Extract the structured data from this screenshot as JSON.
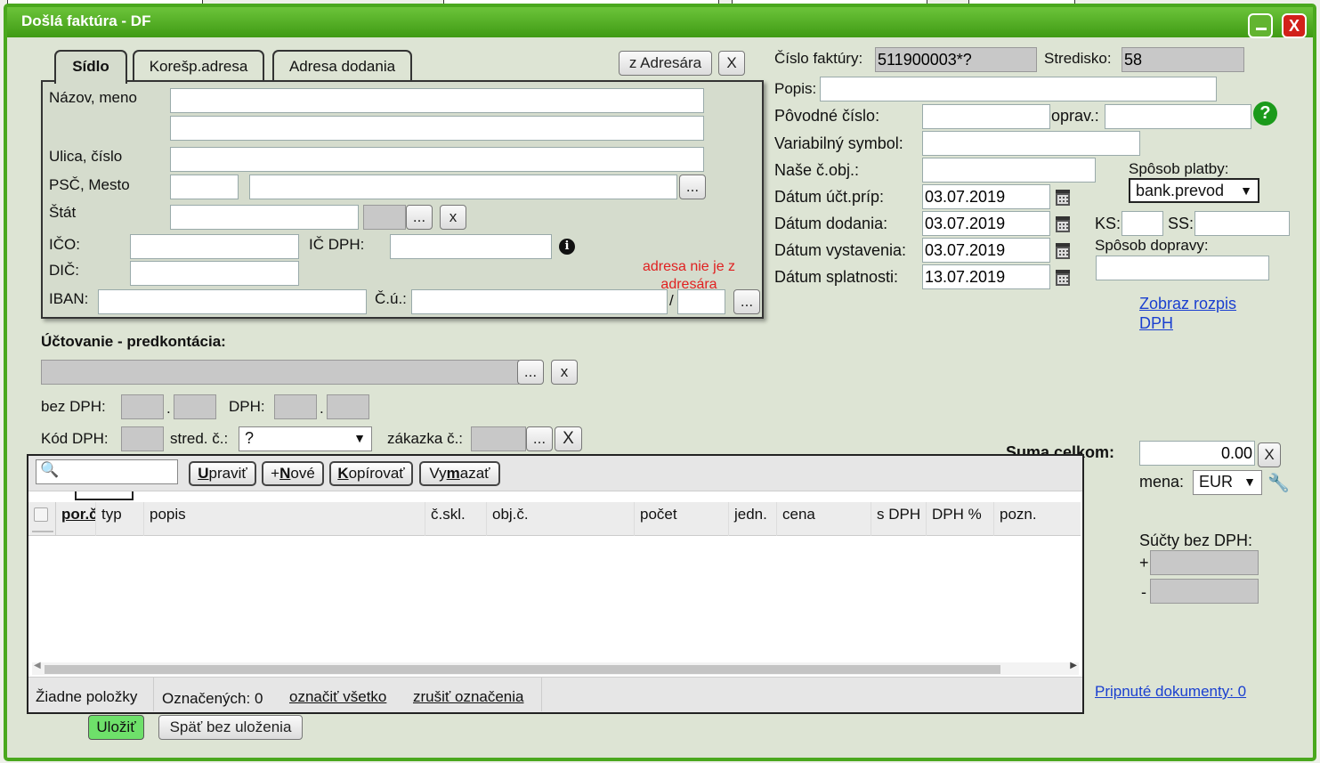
{
  "window": {
    "title": "Došlá faktúra - DF",
    "minimize_icon": "minimize-icon",
    "close_label": "X"
  },
  "address": {
    "tabs": [
      {
        "label": "Sídlo",
        "active": true
      },
      {
        "label": "Korešp.adresa",
        "active": false
      },
      {
        "label": "Adresa dodania",
        "active": false
      }
    ],
    "from_address_book_label": "z Adresára",
    "clear_label": "X",
    "name_label": "Názov, meno",
    "street_label": "Ulica, číslo",
    "zip_city_label": "PSČ, Mesto",
    "country_label": "Štát",
    "ico_label": "IČO:",
    "ic_dph_label": "IČ DPH:",
    "dic_label": "DIČ:",
    "iban_label": "IBAN:",
    "account_label": "Č.ú.:",
    "slash": "/",
    "ellipsis": "...",
    "x_label": "x",
    "not_in_book_warning": "adresa nie je z adresára",
    "warning_color": "#e02020"
  },
  "accounting": {
    "heading": "Účtovanie - predkontácia:",
    "ellipsis": "...",
    "x_label": "x",
    "bez_dph_label": "bez DPH:",
    "dph_label": "DPH:",
    "dot": ".",
    "kod_dph_label": "Kód DPH:",
    "stred_label": "stred. č.:",
    "stred_value": "?",
    "zakazka_label": "zákazka č.:",
    "zakazka_x": "X"
  },
  "invoice": {
    "number_label": "Číslo faktúry:",
    "number_value": "511900003*?",
    "center_label": "Stredisko:",
    "center_value": "58",
    "desc_label": "Popis:",
    "original_label": "Pôvodné číslo:",
    "correction_label": "oprav.:",
    "variable_symbol_label": "Variabilný symbol:",
    "our_order_label": "Naše č.obj.:",
    "payment_method_label": "Spôsob platby:",
    "payment_method_value": "bank.prevod",
    "accounting_date_label": "Dátum účt.príp:",
    "accounting_date_value": "03.07.2019",
    "delivery_date_label": "Dátum dodania:",
    "delivery_date_value": "03.07.2019",
    "issue_date_label": "Dátum vystavenia:",
    "issue_date_value": "03.07.2019",
    "due_date_label": "Dátum splatnosti:",
    "due_date_value": "13.07.2019",
    "ks_label": "KS:",
    "ss_label": "SS:",
    "transport_label": "Spôsob dopravy:",
    "vat_breakdown_link": "Zobraz rozpis DPH",
    "help_icon": "help-icon"
  },
  "totals": {
    "sum_label": "Suma celkom:",
    "sum_value": "0.00",
    "sum_x": "X",
    "currency_label": "mena:",
    "currency_value": "EUR",
    "sums_without_vat_label": "Súčty bez DPH:",
    "plus": "+",
    "minus": "-",
    "attached_docs_link": "Pripnuté dokumenty: 0"
  },
  "grid": {
    "search_placeholder": "",
    "buttons": {
      "edit": {
        "pre": "",
        "key": "U",
        "post": "praviť"
      },
      "new": {
        "pre": "+",
        "key": "N",
        "post": "ové"
      },
      "copy": {
        "pre": "",
        "key": "K",
        "post": "opírovať"
      },
      "delete": {
        "pre": "Vy",
        "key": "m",
        "post": "azať"
      }
    },
    "columns": [
      "por.č",
      "typ",
      "popis",
      "č.skl.",
      "obj.č.",
      "počet",
      "jedn.",
      "cena",
      "s DPH",
      "DPH %",
      "pozn."
    ],
    "empty_text": "Žiadne položky",
    "marked_count": "Označených: 0",
    "select_all": "označiť všetko",
    "deselect": "zrušiť označenia"
  },
  "footer": {
    "save_label": "Uložiť",
    "back_label": "Späť bez uloženia"
  },
  "colors": {
    "accent": "#4aa81e",
    "link": "#1a3fd0"
  }
}
